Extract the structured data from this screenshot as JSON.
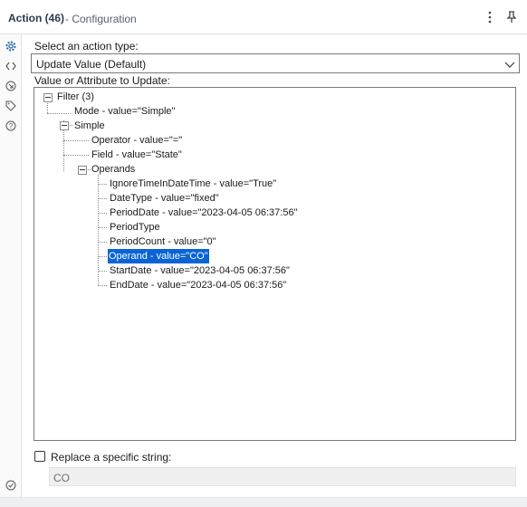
{
  "header": {
    "title": "Action (46)",
    "subtitle": "- Configuration",
    "icons": [
      "kebab-menu-icon",
      "pin-icon"
    ]
  },
  "sidebar": {
    "icons": [
      "gear-icon",
      "code-icon",
      "arrow-circle-icon",
      "tag-icon",
      "help-icon",
      "check-circle-icon"
    ],
    "active_icon": "gear-icon",
    "accent": "#2b6cb0"
  },
  "form": {
    "action_type_label": "Select an action type:",
    "action_type_value": "Update Value (Default)",
    "tree_label": "Value or Attribute to Update:",
    "replace_label": "Replace a specific string:",
    "replace_checked": false,
    "replace_value": "CO"
  },
  "tree": {
    "filter": "Filter (3)",
    "mode": "Mode - value=\"Simple\"",
    "simple": "Simple",
    "operator": "Operator - value=\"=\"",
    "field": "Field - value=\"State\"",
    "operands": "Operands",
    "ignore_time": "IgnoreTimeInDateTime - value=\"True\"",
    "date_type": "DateType - value=\"fixed\"",
    "period_date": "PeriodDate - value=\"2023-04-05 06:37:56\"",
    "period_type": "PeriodType",
    "period_count": "PeriodCount - value=\"0\"",
    "operand": "Operand - value=\"CO\"",
    "start_date": "StartDate - value=\"2023-04-05 06:37:56\"",
    "end_date": "EndDate - value=\"2023-04-05 06:37:56\"",
    "selected_item": "Operand - value=\"CO\"",
    "selection_color": "#0a64d6"
  }
}
